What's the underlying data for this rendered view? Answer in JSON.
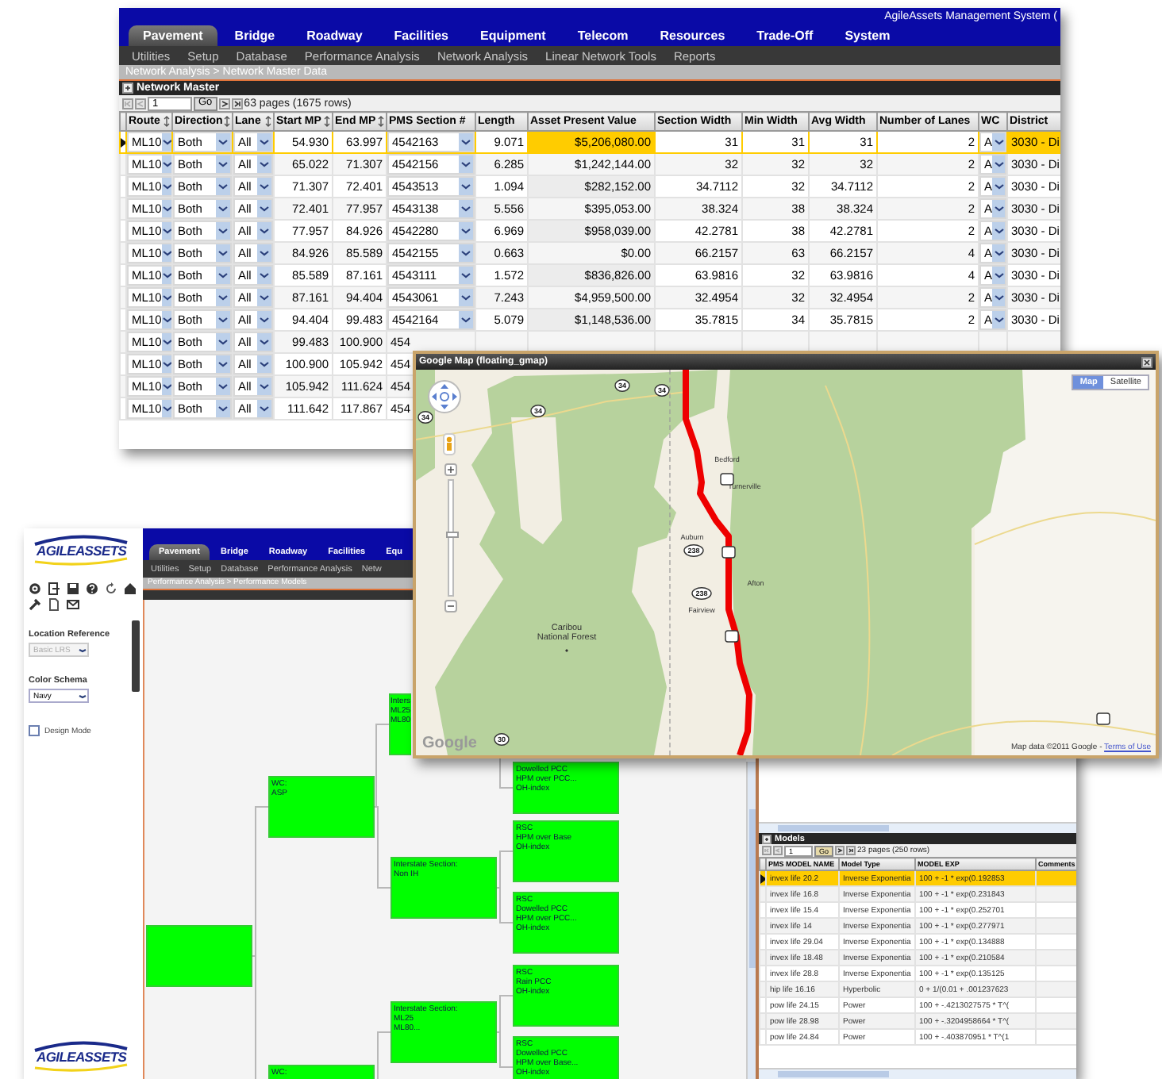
{
  "network_window": {
    "title": "AgileAssets Management System (",
    "tabs": [
      {
        "label": "Pavement",
        "selected": true
      },
      {
        "label": "Bridge",
        "selected": false
      },
      {
        "label": "Roadway",
        "selected": false
      },
      {
        "label": "Facilities",
        "selected": false
      },
      {
        "label": "Equipment",
        "selected": false
      },
      {
        "label": "Telecom",
        "selected": false
      },
      {
        "label": "Resources",
        "selected": false
      },
      {
        "label": "Trade-Off",
        "selected": false
      },
      {
        "label": "System",
        "selected": false
      }
    ],
    "subtabs": [
      "Utilities",
      "Setup",
      "Database",
      "Performance Analysis",
      "Network Analysis",
      "Linear Network Tools",
      "Reports"
    ],
    "breadcrumb": "Network Analysis > Network Master Data",
    "panel_title": "Network Master",
    "pager": {
      "page": "1",
      "go": "Go",
      "info": "63 pages (1675 rows)"
    },
    "table": {
      "columns": [
        {
          "label": "Route",
          "kind": "dropdown",
          "sortable": true
        },
        {
          "label": "Direction",
          "kind": "dropdown",
          "sortable": true
        },
        {
          "label": "Lane",
          "kind": "dropdown",
          "sortable": true
        },
        {
          "label": "Start MP",
          "kind": "number",
          "sortable": true
        },
        {
          "label": "End MP",
          "kind": "number",
          "sortable": true
        },
        {
          "label": "PMS Section #",
          "kind": "dropdown",
          "sortable": false
        },
        {
          "label": "Length",
          "kind": "number",
          "sortable": false
        },
        {
          "label": "Asset Present Value",
          "kind": "money",
          "sortable": false
        },
        {
          "label": "Section Width",
          "kind": "number",
          "sortable": false
        },
        {
          "label": "Min Width",
          "kind": "number",
          "sortable": false
        },
        {
          "label": "Avg Width",
          "kind": "number",
          "sortable": false
        },
        {
          "label": "Number of Lanes",
          "kind": "number",
          "sortable": false
        },
        {
          "label": "WC",
          "kind": "dropdown",
          "sortable": false
        },
        {
          "label": "District",
          "kind": "text",
          "sortable": false
        }
      ],
      "rows": [
        {
          "selected": true,
          "cells": [
            "ML10",
            "Both",
            "All",
            "54.930",
            "63.997",
            "4542163",
            "9.071",
            "$5,206,080.00",
            "31",
            "31",
            "31",
            "2",
            "A",
            "3030 - Di"
          ]
        },
        {
          "selected": false,
          "cells": [
            "ML10",
            "Both",
            "All",
            "65.022",
            "71.307",
            "4542156",
            "6.285",
            "$1,242,144.00",
            "32",
            "32",
            "32",
            "2",
            "A",
            "3030 - Di"
          ]
        },
        {
          "selected": false,
          "cells": [
            "ML10",
            "Both",
            "All",
            "71.307",
            "72.401",
            "4543513",
            "1.094",
            "$282,152.00",
            "34.7112",
            "32",
            "34.7112",
            "2",
            "A",
            "3030 - Di"
          ]
        },
        {
          "selected": false,
          "cells": [
            "ML10",
            "Both",
            "All",
            "72.401",
            "77.957",
            "4543138",
            "5.556",
            "$395,053.00",
            "38.324",
            "38",
            "38.324",
            "2",
            "A",
            "3030 - Di"
          ]
        },
        {
          "selected": false,
          "cells": [
            "ML10",
            "Both",
            "All",
            "77.957",
            "84.926",
            "4542280",
            "6.969",
            "$958,039.00",
            "42.2781",
            "38",
            "42.2781",
            "2",
            "A",
            "3030 - Di"
          ]
        },
        {
          "selected": false,
          "cells": [
            "ML10",
            "Both",
            "All",
            "84.926",
            "85.589",
            "4542155",
            "0.663",
            "$0.00",
            "66.2157",
            "63",
            "66.2157",
            "4",
            "A",
            "3030 - Di"
          ]
        },
        {
          "selected": false,
          "cells": [
            "ML10",
            "Both",
            "All",
            "85.589",
            "87.161",
            "4543111",
            "1.572",
            "$836,826.00",
            "63.9816",
            "32",
            "63.9816",
            "4",
            "A",
            "3030 - Di"
          ]
        },
        {
          "selected": false,
          "cells": [
            "ML10",
            "Both",
            "All",
            "87.161",
            "94.404",
            "4543061",
            "7.243",
            "$4,959,500.00",
            "32.4954",
            "32",
            "32.4954",
            "2",
            "A",
            "3030 - Di"
          ]
        },
        {
          "selected": false,
          "cells": [
            "ML10",
            "Both",
            "All",
            "94.404",
            "99.483",
            "4542164",
            "5.079",
            "$1,148,536.00",
            "35.7815",
            "34",
            "35.7815",
            "2",
            "A",
            "3030 - Di"
          ]
        },
        {
          "selected": false,
          "cells": [
            "ML10",
            "Both",
            "All",
            "99.483",
            "100.900",
            "454"
          ]
        },
        {
          "selected": false,
          "cells": [
            "ML10",
            "Both",
            "All",
            "100.900",
            "105.942",
            "454"
          ]
        },
        {
          "selected": false,
          "cells": [
            "ML10",
            "Both",
            "All",
            "105.942",
            "111.624",
            "454"
          ]
        },
        {
          "selected": false,
          "cells": [
            "ML10",
            "Both",
            "All",
            "111.642",
            "117.867",
            "454"
          ]
        }
      ]
    }
  },
  "map_window": {
    "title": "Google Map (floating_gmap)",
    "map_types": [
      {
        "label": "Map",
        "selected": true
      },
      {
        "label": "Satellite",
        "selected": false
      }
    ],
    "zoom": {
      "level": 0.55
    },
    "places": [
      "Caribou National Forest",
      "Bedford",
      "Turnerville",
      "Auburn",
      "Afton",
      "Fairview"
    ],
    "shields": [
      "34",
      "34",
      "34",
      "34",
      "238",
      "238",
      "30"
    ],
    "logo": "Google",
    "attribution": "Map data ©2011 Google - ",
    "terms_link": "Terms of Use"
  },
  "models_window": {
    "logo": "AGILEASSETS",
    "fields": [
      {
        "label": "Location Reference",
        "value": "Basic LRS",
        "disabled": true
      },
      {
        "label": "Color Schema",
        "value": "Navy",
        "disabled": false
      }
    ],
    "design_mode": {
      "label": "Design Mode",
      "checked": false
    },
    "footer_logo": "AGILEASSETS",
    "tabs": [
      {
        "label": "Pavement",
        "selected": true
      },
      {
        "label": "Bridge",
        "selected": false
      },
      {
        "label": "Roadway",
        "selected": false
      },
      {
        "label": "Facilities",
        "selected": false
      },
      {
        "label": "Equ",
        "selected": false
      }
    ],
    "subtabs": [
      "Utilities",
      "Setup",
      "Database",
      "Performance Analysis",
      "Netw"
    ],
    "breadcrumb": "Performance Analysis > Performance Models",
    "tree": {
      "children": [
        {
          "lines": [
            "WC:",
            "ASP"
          ],
          "children": [
            {
              "lines": [
                "Inters",
                "ML25",
                "ML80"
              ],
              "children": [
                {
                  "lines": [
                    "Dowelled PCC",
                    "HPM over PCC...",
                    "OH-index"
                  ]
                }
              ]
            },
            {
              "lines": [
                "Interstate Section:",
                "Non IH"
              ],
              "children": [
                {
                  "lines": [
                    "RSC",
                    "HPM over Base",
                    "OH-index"
                  ]
                },
                {
                  "lines": [
                    "RSC",
                    "Dowelled PCC",
                    "HPM over PCC...",
                    "OH-index"
                  ]
                }
              ]
            }
          ]
        },
        {
          "lines": [
            "WC:"
          ],
          "children": [
            {
              "lines": [
                "Interstate Section:",
                "ML25",
                "ML80..."
              ],
              "children": [
                {
                  "lines": [
                    "RSC",
                    "Rain PCC",
                    "OH-index"
                  ]
                },
                {
                  "lines": [
                    "RSC",
                    "Dowelled PCC",
                    "HPM over Base...",
                    "OH-index"
                  ]
                }
              ]
            }
          ]
        }
      ]
    },
    "models": {
      "title": "Models",
      "pager": {
        "page": "1",
        "go": "Go",
        "info": "23 pages (250 rows)"
      },
      "columns": [
        "PMS MODEL NAME",
        "Model Type",
        "MODEL EXP",
        "Comments"
      ],
      "rows": [
        {
          "selected": true,
          "cells": [
            "invex life 20.2",
            "Inverse Exponentia",
            "100 + -1 * exp(0.192853"
          ]
        },
        {
          "selected": false,
          "cells": [
            "invex life 16.8",
            "Inverse Exponentia",
            "100 + -1 * exp(0.231843"
          ]
        },
        {
          "selected": false,
          "cells": [
            "invex life 15.4",
            "Inverse Exponentia",
            "100 + -1 * exp(0.252701"
          ]
        },
        {
          "selected": false,
          "cells": [
            "invex life 14",
            "Inverse Exponentia",
            "100 + -1 * exp(0.277971"
          ]
        },
        {
          "selected": false,
          "cells": [
            "invex life 29.04",
            "Inverse Exponentia",
            "100 + -1 * exp(0.134888"
          ]
        },
        {
          "selected": false,
          "cells": [
            "invex life 18.48",
            "Inverse Exponentia",
            "100 + -1 * exp(0.210584"
          ]
        },
        {
          "selected": false,
          "cells": [
            "invex life 28.8",
            "Inverse Exponentia",
            "100 + -1 * exp(0.135125"
          ]
        },
        {
          "selected": false,
          "cells": [
            "hip life 16.16",
            "Hyperbolic",
            "0 + 1/(0.01 + .001237623"
          ]
        },
        {
          "selected": false,
          "cells": [
            "pow life 24.15",
            "Power",
            "100 + -.4213027575 * T^("
          ]
        },
        {
          "selected": false,
          "cells": [
            "pow life 28.98",
            "Power",
            "100 + -.3204958664 * T^("
          ]
        },
        {
          "selected": false,
          "cells": [
            "pow life 24.84",
            "Power",
            "100 + -.403870951 * T^(1"
          ]
        }
      ]
    }
  }
}
